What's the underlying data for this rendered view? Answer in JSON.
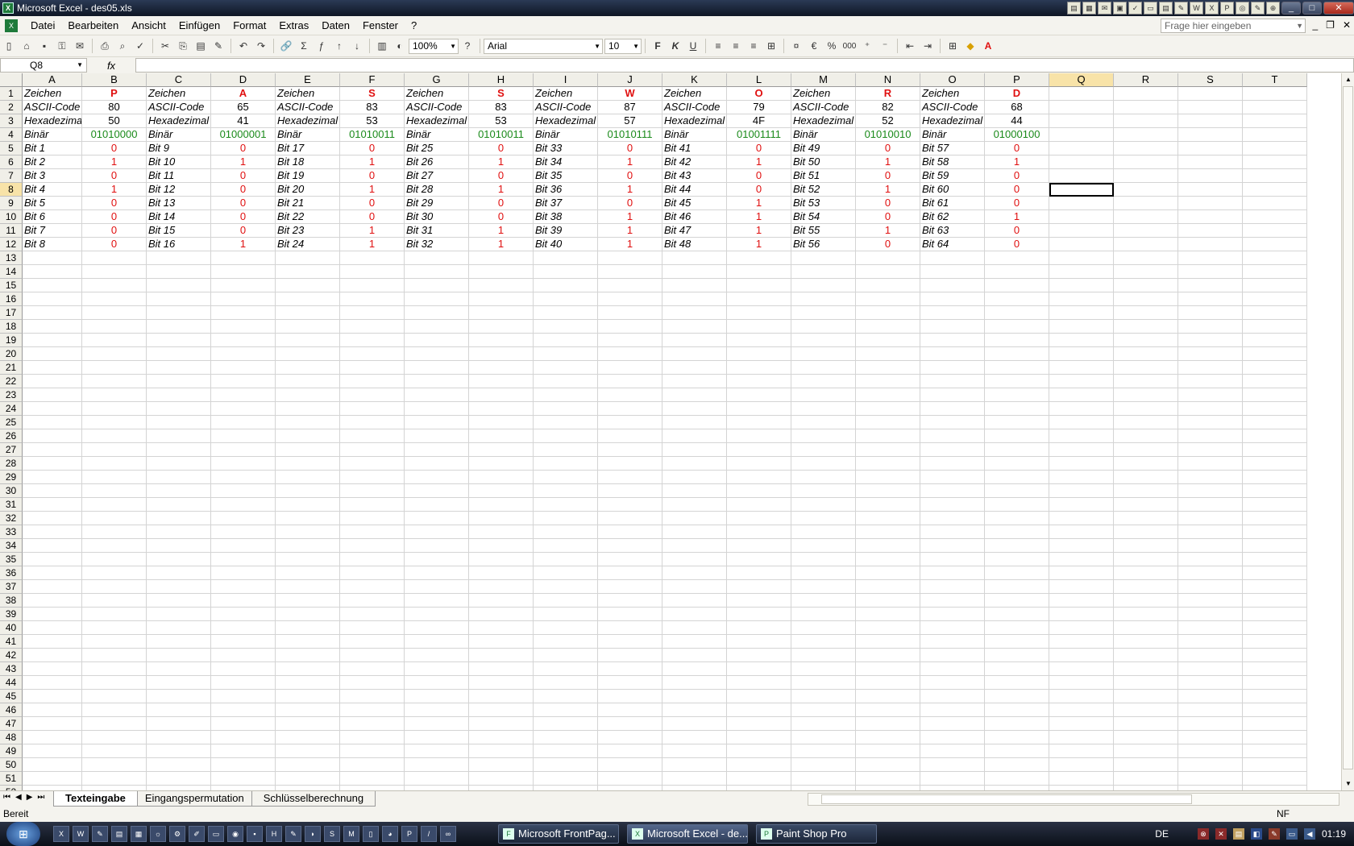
{
  "titlebar": {
    "title": "Microsoft Excel - des05.xls"
  },
  "menu": {
    "items": [
      "Datei",
      "Bearbeiten",
      "Ansicht",
      "Einfügen",
      "Format",
      "Extras",
      "Daten",
      "Fenster",
      "?"
    ],
    "help_placeholder": "Frage hier eingeben"
  },
  "toolbar": {
    "zoom": "100%",
    "font": "Arial",
    "size": "10",
    "bold": "F",
    "italic": "K",
    "underline": "U",
    "euro": "€",
    "percent": "%",
    "thousands": "000",
    "sigma": "Σ"
  },
  "formula": {
    "cell_ref": "Q8",
    "fx": "fx",
    "value": ""
  },
  "columns": [
    "A",
    "B",
    "C",
    "D",
    "E",
    "F",
    "G",
    "H",
    "I",
    "J",
    "K",
    "L",
    "M",
    "N",
    "O",
    "P",
    "Q",
    "R",
    "S",
    "T"
  ],
  "selected_column": "Q",
  "selected_row": 8,
  "row_count": 52,
  "rows": [
    [
      "Zeichen",
      "P",
      "Zeichen",
      "A",
      "Zeichen",
      "S",
      "Zeichen",
      "S",
      "Zeichen",
      "W",
      "Zeichen",
      "O",
      "Zeichen",
      "R",
      "Zeichen",
      "D"
    ],
    [
      "ASCII-Code",
      "80",
      "ASCII-Code",
      "65",
      "ASCII-Code",
      "83",
      "ASCII-Code",
      "83",
      "ASCII-Code",
      "87",
      "ASCII-Code",
      "79",
      "ASCII-Code",
      "82",
      "ASCII-Code",
      "68"
    ],
    [
      "Hexadezimal",
      "50",
      "Hexadezimal",
      "41",
      "Hexadezimal",
      "53",
      "Hexadezimal",
      "53",
      "Hexadezimal",
      "57",
      "Hexadezimal",
      "4F",
      "Hexadezimal",
      "52",
      "Hexadezimal",
      "44"
    ],
    [
      "Binär",
      "01010000",
      "Binär",
      "01000001",
      "Binär",
      "01010011",
      "Binär",
      "01010011",
      "Binär",
      "01010111",
      "Binär",
      "01001111",
      "Binär",
      "01010010",
      "Binär",
      "01000100"
    ],
    [
      "Bit 1",
      "0",
      "Bit 9",
      "0",
      "Bit 17",
      "0",
      "Bit 25",
      "0",
      "Bit 33",
      "0",
      "Bit 41",
      "0",
      "Bit 49",
      "0",
      "Bit 57",
      "0"
    ],
    [
      "Bit 2",
      "1",
      "Bit 10",
      "1",
      "Bit 18",
      "1",
      "Bit 26",
      "1",
      "Bit 34",
      "1",
      "Bit 42",
      "1",
      "Bit 50",
      "1",
      "Bit 58",
      "1"
    ],
    [
      "Bit 3",
      "0",
      "Bit 11",
      "0",
      "Bit 19",
      "0",
      "Bit 27",
      "0",
      "Bit 35",
      "0",
      "Bit 43",
      "0",
      "Bit 51",
      "0",
      "Bit 59",
      "0"
    ],
    [
      "Bit 4",
      "1",
      "Bit 12",
      "0",
      "Bit 20",
      "1",
      "Bit 28",
      "1",
      "Bit 36",
      "1",
      "Bit 44",
      "0",
      "Bit 52",
      "1",
      "Bit 60",
      "0"
    ],
    [
      "Bit 5",
      "0",
      "Bit 13",
      "0",
      "Bit 21",
      "0",
      "Bit 29",
      "0",
      "Bit 37",
      "0",
      "Bit 45",
      "1",
      "Bit 53",
      "0",
      "Bit 61",
      "0"
    ],
    [
      "Bit 6",
      "0",
      "Bit 14",
      "0",
      "Bit 22",
      "0",
      "Bit 30",
      "0",
      "Bit 38",
      "1",
      "Bit 46",
      "1",
      "Bit 54",
      "0",
      "Bit 62",
      "1"
    ],
    [
      "Bit 7",
      "0",
      "Bit 15",
      "0",
      "Bit 23",
      "1",
      "Bit 31",
      "1",
      "Bit 39",
      "1",
      "Bit 47",
      "1",
      "Bit 55",
      "1",
      "Bit 63",
      "0"
    ],
    [
      "Bit 8",
      "0",
      "Bit 16",
      "1",
      "Bit 24",
      "1",
      "Bit 32",
      "1",
      "Bit 40",
      "1",
      "Bit 48",
      "1",
      "Bit 56",
      "0",
      "Bit 64",
      "0"
    ]
  ],
  "sheets": {
    "tabs": [
      "Texteingabe",
      "Eingangspermutation",
      "Schlüsselberechnung"
    ],
    "active": "Texteingabe"
  },
  "status": {
    "left": "Bereit",
    "right": "NF"
  },
  "taskbar": {
    "tasks": [
      "Microsoft FrontPag...",
      "Microsoft Excel - de...",
      "Paint Shop Pro"
    ],
    "lang": "DE",
    "clock": "01:19"
  },
  "colors": {
    "accent_red": "#e01010",
    "binary_green": "#1a8a1a",
    "selection": "#f8e3a8"
  }
}
